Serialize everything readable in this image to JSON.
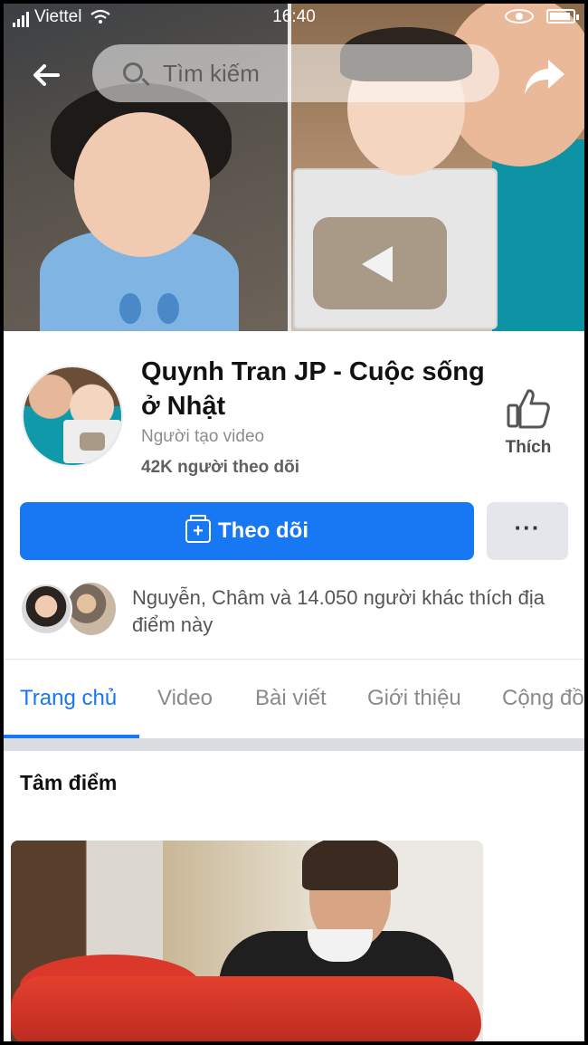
{
  "status_bar": {
    "carrier": "Viettel",
    "time": "16:40"
  },
  "search": {
    "placeholder": "Tìm kiếm"
  },
  "icons": {
    "back": "back-arrow-icon",
    "search": "search-icon",
    "share": "share-icon",
    "like": "thumbs-up-icon",
    "follow": "follow-page-icon",
    "more": "more-icon"
  },
  "profile": {
    "name": "Quynh Tran JP - Cuộc sống ở Nhật",
    "category": "Người tạo video",
    "followers": "42K người theo dõi",
    "like_label": "Thích"
  },
  "actions": {
    "follow_label": "Theo dõi",
    "more_label": "···"
  },
  "friends": {
    "text": "Nguyễn, Châm và 14.050 người khác thích địa điểm này"
  },
  "tabs": [
    {
      "label": "Trang chủ",
      "active": true
    },
    {
      "label": "Video",
      "active": false
    },
    {
      "label": "Bài viết",
      "active": false
    },
    {
      "label": "Giới thiệu",
      "active": false
    },
    {
      "label": "Cộng đồ",
      "active": false
    }
  ],
  "highlights": {
    "title": "Tâm điểm"
  },
  "colors": {
    "accent": "#1877f2",
    "secondary_button": "#e4e6eb"
  }
}
